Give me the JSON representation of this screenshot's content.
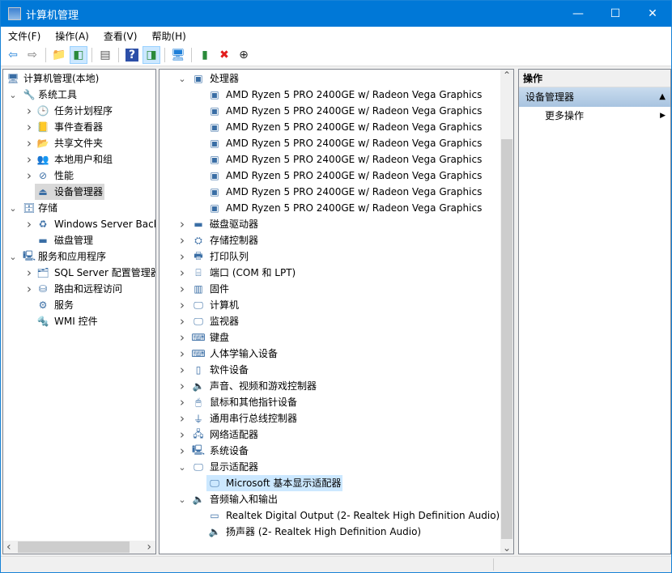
{
  "window": {
    "title": "计算机管理",
    "minimize": "—",
    "maximize": "☐",
    "close": "✕"
  },
  "menu": [
    "文件(F)",
    "操作(A)",
    "查看(V)",
    "帮助(H)"
  ],
  "toolbar": [
    {
      "name": "back-icon",
      "glyph": "⇦",
      "color": "#1e7fd8"
    },
    {
      "name": "forward-icon",
      "glyph": "⇨",
      "color": "#777"
    },
    {
      "sep": true
    },
    {
      "name": "up-folder-icon",
      "glyph": "📁",
      "color": "#d4a017"
    },
    {
      "name": "show-hide-tree-icon",
      "glyph": "◧",
      "color": "#2a8a3a",
      "on": true
    },
    {
      "sep": true
    },
    {
      "name": "properties-icon",
      "glyph": "▤",
      "color": "#555"
    },
    {
      "sep": true
    },
    {
      "name": "help-icon",
      "glyph": "?",
      "color": "#fff",
      "bg": "#2c4fa8"
    },
    {
      "name": "show-action-pane-icon",
      "glyph": "◨",
      "color": "#2a8a3a",
      "on": true
    },
    {
      "sep": true
    },
    {
      "name": "scan-hardware-icon",
      "glyph": "🖥",
      "color": "#1e7fd8"
    },
    {
      "sep": true
    },
    {
      "name": "update-driver-icon",
      "glyph": "▮",
      "color": "#2a8a3a"
    },
    {
      "name": "uninstall-icon",
      "glyph": "✖",
      "color": "#e21b1b"
    },
    {
      "name": "disable-device-icon",
      "glyph": "⊕",
      "color": "#222"
    }
  ],
  "left_tree": [
    {
      "label": "计算机管理(本地)",
      "level": 0,
      "icon": "computer-management-icon",
      "glyph": "🖥"
    },
    {
      "label": "系统工具",
      "level": 1,
      "chevron": "down",
      "icon": "system-tools-icon",
      "glyph": "🔧"
    },
    {
      "label": "任务计划程序",
      "level": 2,
      "chevron": "right",
      "icon": "clock-icon",
      "glyph": "🕒"
    },
    {
      "label": "事件查看器",
      "level": 2,
      "chevron": "right",
      "icon": "event-viewer-icon",
      "glyph": "📒"
    },
    {
      "label": "共享文件夹",
      "level": 2,
      "chevron": "right",
      "icon": "shared-folder-icon",
      "glyph": "📂"
    },
    {
      "label": "本地用户和组",
      "level": 2,
      "chevron": "right",
      "icon": "users-icon",
      "glyph": "👥"
    },
    {
      "label": "性能",
      "level": 2,
      "chevron": "right",
      "icon": "performance-icon",
      "glyph": "⊘"
    },
    {
      "label": "设备管理器",
      "level": 2,
      "icon": "device-manager-icon",
      "glyph": "⏏",
      "selected": true
    },
    {
      "label": "存储",
      "level": 1,
      "chevron": "down",
      "icon": "storage-icon",
      "glyph": "🗄"
    },
    {
      "label": "Windows Server Back",
      "level": 2,
      "chevron": "right",
      "icon": "backup-icon",
      "glyph": "♻"
    },
    {
      "label": "磁盘管理",
      "level": 2,
      "icon": "disk-management-icon",
      "glyph": "▬"
    },
    {
      "label": "服务和应用程序",
      "level": 1,
      "chevron": "down",
      "icon": "services-apps-icon",
      "glyph": "🖳"
    },
    {
      "label": "SQL Server 配置管理器",
      "level": 2,
      "chevron": "right",
      "icon": "sql-server-icon",
      "glyph": "🗂"
    },
    {
      "label": "路由和远程访问",
      "level": 2,
      "chevron": "right",
      "icon": "routing-icon",
      "glyph": "⛁"
    },
    {
      "label": "服务",
      "level": 2,
      "icon": "services-icon",
      "glyph": "⚙"
    },
    {
      "label": "WMI 控件",
      "level": 2,
      "icon": "wmi-icon",
      "glyph": "🔩"
    }
  ],
  "device_tree": [
    {
      "label": "处理器",
      "level": 0,
      "chevron": "down",
      "icon": "processor-icon",
      "glyph": "▣"
    },
    {
      "label": "AMD Ryzen 5 PRO 2400GE w/ Radeon Vega Graphics",
      "level": 1,
      "icon": "processor-icon",
      "glyph": "▣"
    },
    {
      "label": "AMD Ryzen 5 PRO 2400GE w/ Radeon Vega Graphics",
      "level": 1,
      "icon": "processor-icon",
      "glyph": "▣"
    },
    {
      "label": "AMD Ryzen 5 PRO 2400GE w/ Radeon Vega Graphics",
      "level": 1,
      "icon": "processor-icon",
      "glyph": "▣"
    },
    {
      "label": "AMD Ryzen 5 PRO 2400GE w/ Radeon Vega Graphics",
      "level": 1,
      "icon": "processor-icon",
      "glyph": "▣"
    },
    {
      "label": "AMD Ryzen 5 PRO 2400GE w/ Radeon Vega Graphics",
      "level": 1,
      "icon": "processor-icon",
      "glyph": "▣"
    },
    {
      "label": "AMD Ryzen 5 PRO 2400GE w/ Radeon Vega Graphics",
      "level": 1,
      "icon": "processor-icon",
      "glyph": "▣"
    },
    {
      "label": "AMD Ryzen 5 PRO 2400GE w/ Radeon Vega Graphics",
      "level": 1,
      "icon": "processor-icon",
      "glyph": "▣"
    },
    {
      "label": "AMD Ryzen 5 PRO 2400GE w/ Radeon Vega Graphics",
      "level": 1,
      "icon": "processor-icon",
      "glyph": "▣"
    },
    {
      "label": "磁盘驱动器",
      "level": 0,
      "chevron": "right",
      "icon": "disk-drive-icon",
      "glyph": "▬"
    },
    {
      "label": "存储控制器",
      "level": 0,
      "chevron": "right",
      "icon": "storage-controller-icon",
      "glyph": "⛭"
    },
    {
      "label": "打印队列",
      "level": 0,
      "chevron": "right",
      "icon": "printer-icon",
      "glyph": "🖶"
    },
    {
      "label": "端口 (COM 和 LPT)",
      "level": 0,
      "chevron": "right",
      "icon": "port-icon",
      "glyph": "⌸"
    },
    {
      "label": "固件",
      "level": 0,
      "chevron": "right",
      "icon": "firmware-icon",
      "glyph": "▥"
    },
    {
      "label": "计算机",
      "level": 0,
      "chevron": "right",
      "icon": "computer-icon",
      "glyph": "🖵"
    },
    {
      "label": "监视器",
      "level": 0,
      "chevron": "right",
      "icon": "monitor-icon",
      "glyph": "🖵"
    },
    {
      "label": "键盘",
      "level": 0,
      "chevron": "right",
      "icon": "keyboard-icon",
      "glyph": "⌨"
    },
    {
      "label": "人体学输入设备",
      "level": 0,
      "chevron": "right",
      "icon": "hid-icon",
      "glyph": "⌨"
    },
    {
      "label": "软件设备",
      "level": 0,
      "chevron": "right",
      "icon": "software-device-icon",
      "glyph": "▯"
    },
    {
      "label": "声音、视频和游戏控制器",
      "level": 0,
      "chevron": "right",
      "icon": "sound-icon",
      "glyph": "🔈"
    },
    {
      "label": "鼠标和其他指针设备",
      "level": 0,
      "chevron": "right",
      "icon": "mouse-icon",
      "glyph": "🖱"
    },
    {
      "label": "通用串行总线控制器",
      "level": 0,
      "chevron": "right",
      "icon": "usb-icon",
      "glyph": "⏚"
    },
    {
      "label": "网络适配器",
      "level": 0,
      "chevron": "right",
      "icon": "network-adapter-icon",
      "glyph": "🖧"
    },
    {
      "label": "系统设备",
      "level": 0,
      "chevron": "right",
      "icon": "system-device-icon",
      "glyph": "🖳"
    },
    {
      "label": "显示适配器",
      "level": 0,
      "chevron": "down",
      "icon": "display-adapter-icon",
      "glyph": "🖵"
    },
    {
      "label": "Microsoft 基本显示适配器",
      "level": 1,
      "icon": "display-adapter-icon",
      "glyph": "🖵",
      "selected": true
    },
    {
      "label": "音频输入和输出",
      "level": 0,
      "chevron": "down",
      "icon": "audio-icon",
      "glyph": "🔈"
    },
    {
      "label": "Realtek Digital Output (2- Realtek High Definition Audio)",
      "level": 1,
      "icon": "digital-output-icon",
      "glyph": "▭"
    },
    {
      "label": "扬声器 (2- Realtek High Definition Audio)",
      "level": 1,
      "icon": "speaker-icon",
      "glyph": "🔈"
    }
  ],
  "actions": {
    "header": "操作",
    "section": "设备管理器",
    "section_arrow": "▲",
    "more": "更多操作",
    "more_arrow": "▶"
  },
  "scroll": {
    "up": "⌃",
    "down": "⌄",
    "left": "‹",
    "right": "›"
  }
}
